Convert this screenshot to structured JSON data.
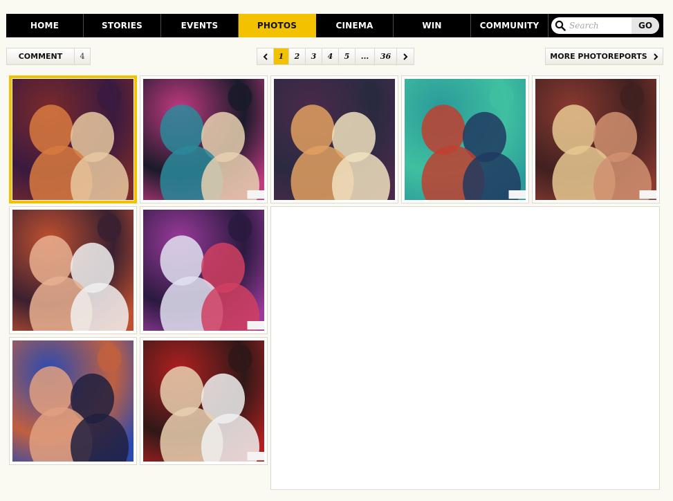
{
  "nav": {
    "items": [
      {
        "label": "HOME"
      },
      {
        "label": "STORIES"
      },
      {
        "label": "EVENTS"
      },
      {
        "label": "PHOTOS",
        "active": true
      },
      {
        "label": "CINEMA"
      },
      {
        "label": "WIN"
      },
      {
        "label": "COMMUNITY"
      }
    ],
    "search_placeholder": "Search",
    "go_label": "GO"
  },
  "toolbar": {
    "comment_label": "COMMENT",
    "comment_count": "4",
    "more_label": "MORE PHOTOREPORTS",
    "pager": {
      "prev_icon": "chevron-left-icon",
      "next_icon": "chevron-right-icon",
      "pages": [
        "1",
        "2",
        "3",
        "4",
        "5",
        "...",
        "36"
      ],
      "current": "1"
    }
  },
  "colors": {
    "accent": "#f2c200",
    "nav_bg": "#000000",
    "page_bg": "#fbfaf2"
  },
  "watermark": "tilla",
  "photos": [
    {
      "id": "photo-1",
      "selected": true,
      "palette": [
        "#7a2a2a",
        "#d87a40",
        "#e8c8a0",
        "#3a1a40"
      ]
    },
    {
      "id": "photo-2",
      "palette": [
        "#c03a80",
        "#2a8a9a",
        "#e8d0b0",
        "#1a1a2a"
      ]
    },
    {
      "id": "photo-3",
      "palette": [
        "#4a2a4a",
        "#e0a060",
        "#f0e0c0",
        "#2a2a40"
      ]
    },
    {
      "id": "photo-4",
      "palette": [
        "#2a9a9a",
        "#c04030",
        "#203a60",
        "#40c0a0"
      ]
    },
    {
      "id": "photo-5",
      "palette": [
        "#8a3a30",
        "#e8c890",
        "#d09070",
        "#402020"
      ]
    },
    {
      "id": "photo-6",
      "palette": [
        "#c05030",
        "#e8b090",
        "#f0f0f0",
        "#3a2030"
      ]
    },
    {
      "id": "photo-7",
      "palette": [
        "#9a3a9a",
        "#e0e0f0",
        "#d04060",
        "#2a1a40"
      ]
    },
    {
      "id": "photo-8",
      "palette": [
        "#2a4ab0",
        "#e0a080",
        "#202040",
        "#c06040"
      ]
    },
    {
      "id": "photo-9",
      "palette": [
        "#b02020",
        "#e8d0b0",
        "#f0f0f0",
        "#301818"
      ]
    }
  ]
}
